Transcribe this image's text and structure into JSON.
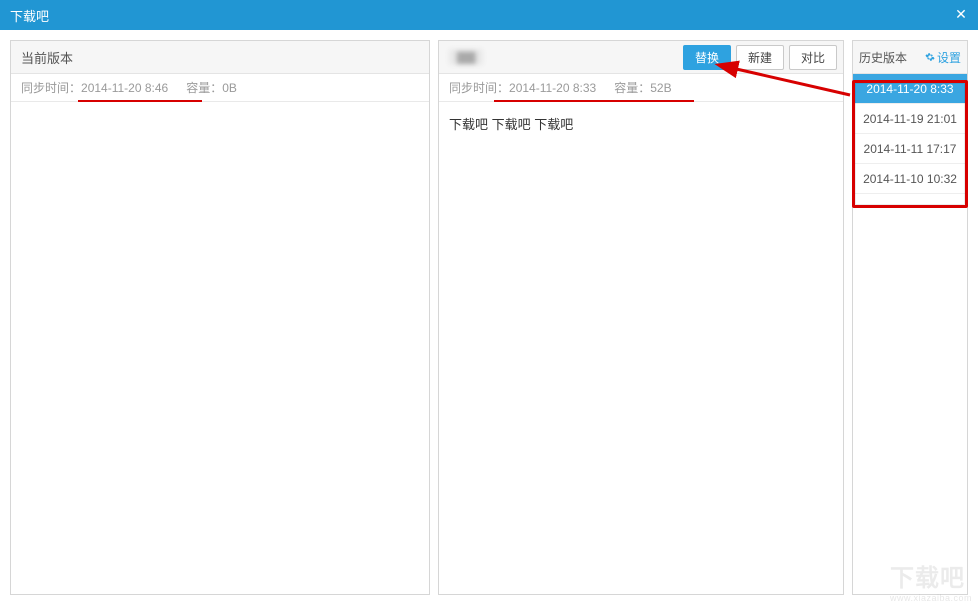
{
  "titlebar": {
    "title": "下载吧"
  },
  "left": {
    "header_label": "当前版本",
    "sync_label": "同步时间：",
    "sync_value": "2014-11-20 8:46",
    "size_label": "容量：",
    "size_value": "0B"
  },
  "mid": {
    "header_placeholder": "▇▇",
    "buttons": {
      "replace": "替换",
      "create": "新建",
      "compare": "对比"
    },
    "sync_label": "同步时间：",
    "sync_value": "2014-11-20 8:33",
    "size_label": "容量：",
    "size_value": "52B",
    "body_text": "下载吧 下载吧 下载吧"
  },
  "right": {
    "header_label": "历史版本",
    "settings_label": "设置",
    "history": [
      {
        "time": "2014-11-20 8:33",
        "selected": true
      },
      {
        "time": "2014-11-19 21:01",
        "selected": false
      },
      {
        "time": "2014-11-11 17:17",
        "selected": false
      },
      {
        "time": "2014-11-10 10:32",
        "selected": false
      }
    ]
  },
  "watermark": {
    "big": "下载吧",
    "url": "www.xiazaiba.com"
  }
}
